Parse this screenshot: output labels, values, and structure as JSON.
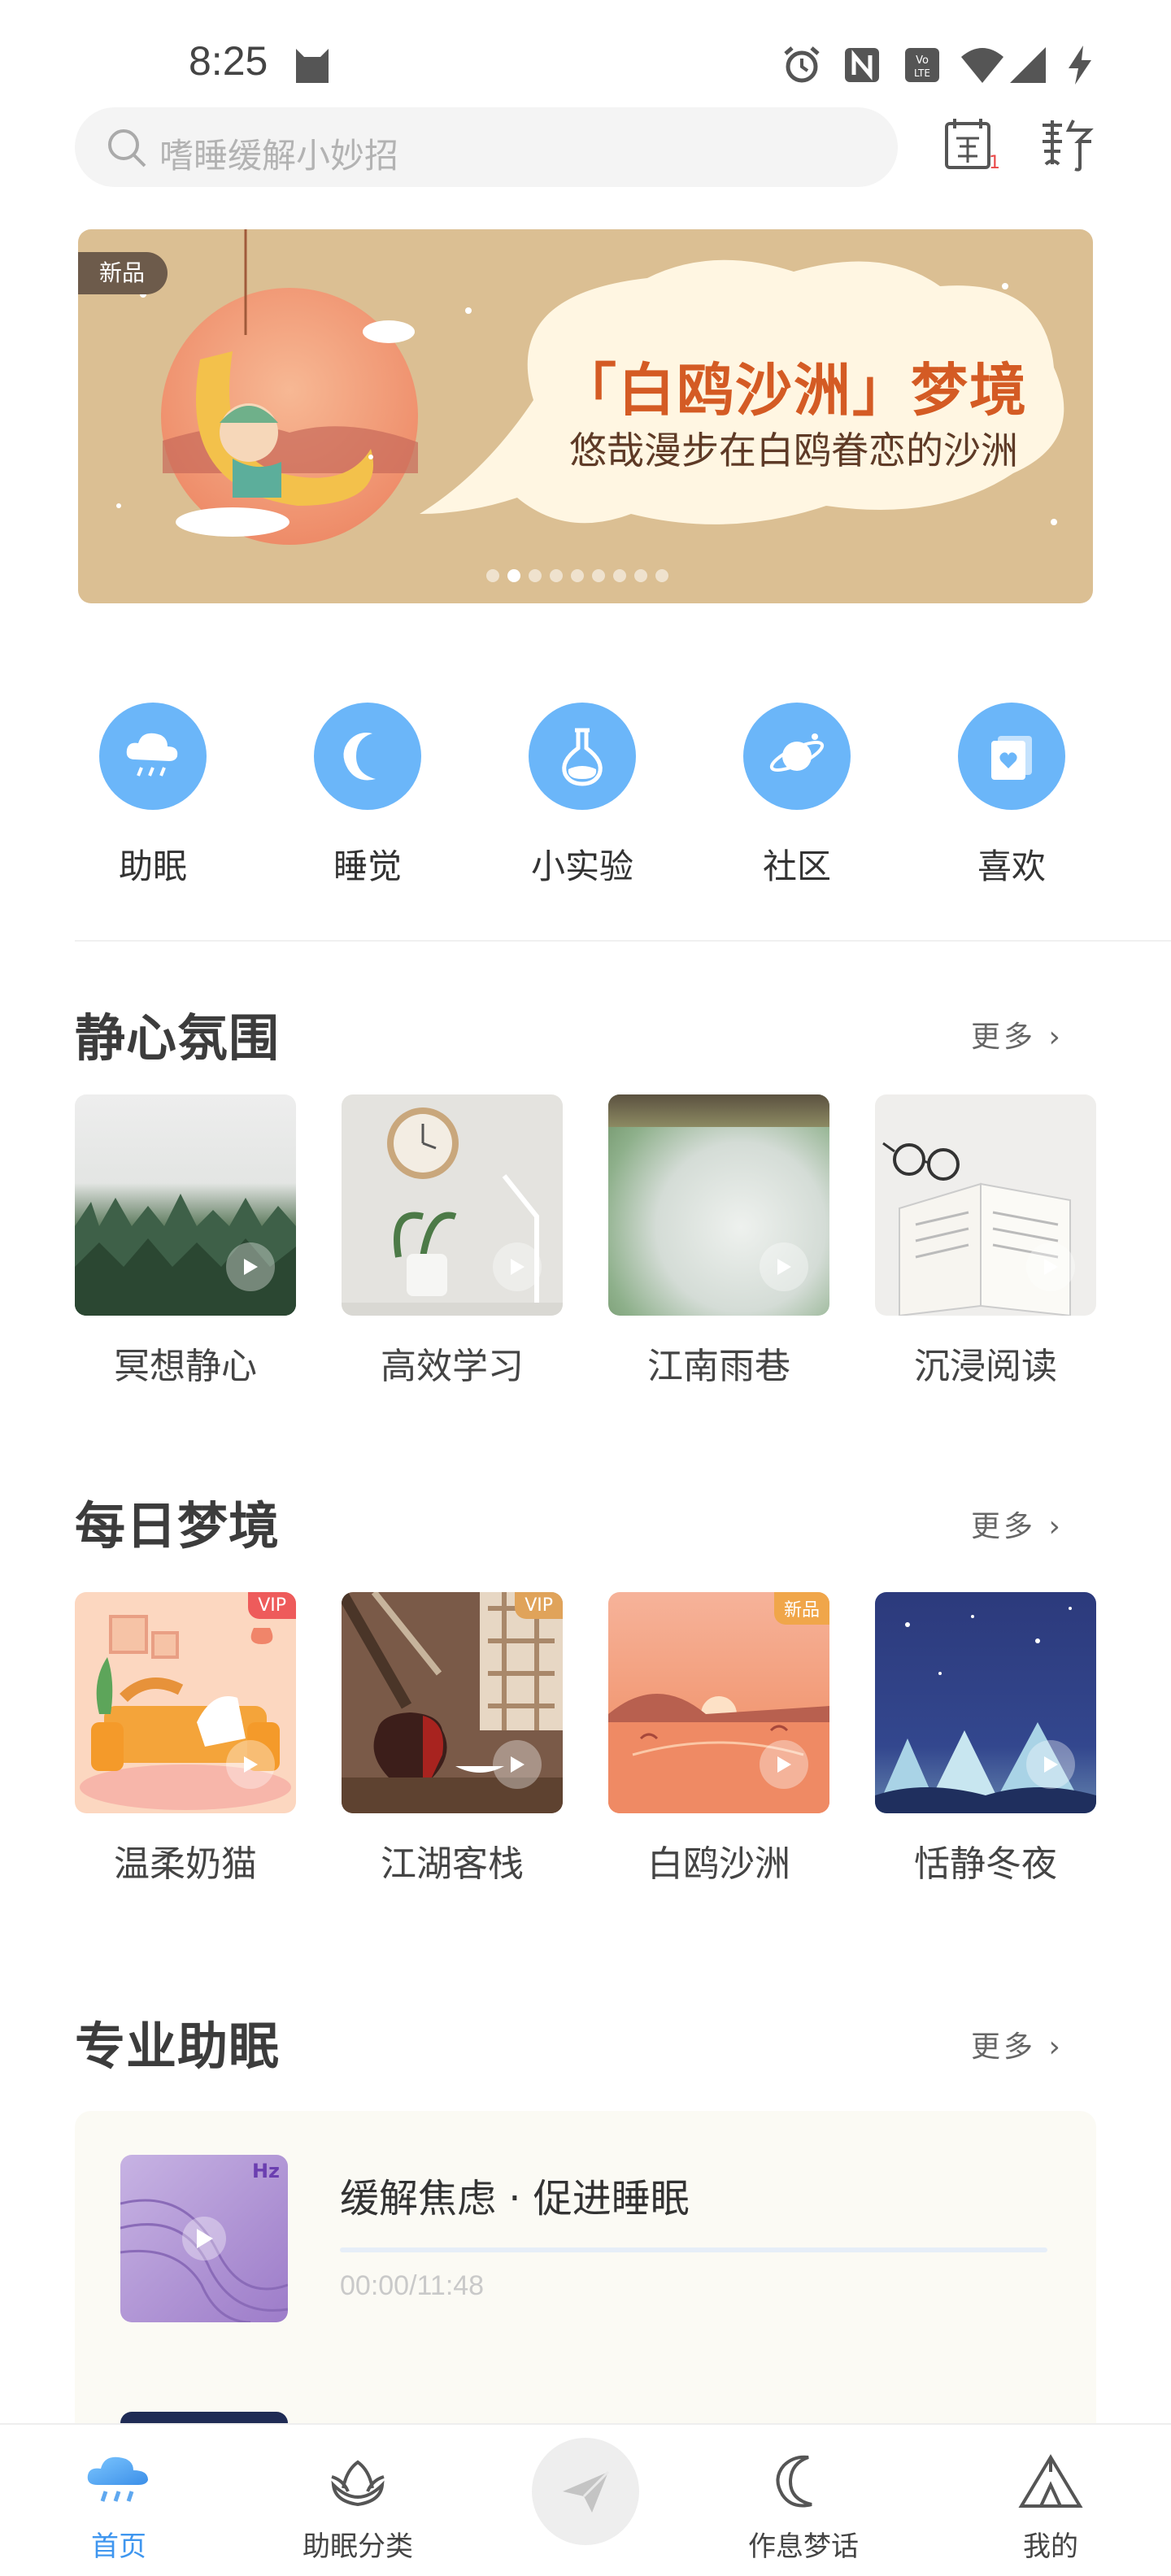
{
  "status_bar": {
    "time": "8:25"
  },
  "search": {
    "placeholder": "嗜睡缓解小妙招"
  },
  "header_right": {
    "checkin_badge": "1"
  },
  "banner": {
    "badge": "新品",
    "title": "「白鸥沙洲」梦境",
    "subtitle": "悠哉漫步在白鸥眷恋的沙洲",
    "page_count": 9,
    "active_page": 2
  },
  "quick_nav": [
    {
      "label": "助眠",
      "icon": "cloud-rain-icon"
    },
    {
      "label": "睡觉",
      "icon": "moon-icon"
    },
    {
      "label": "小实验",
      "icon": "flask-icon"
    },
    {
      "label": "社区",
      "icon": "planet-icon"
    },
    {
      "label": "喜欢",
      "icon": "heart-card-icon"
    }
  ],
  "sections": {
    "calm": {
      "title": "静心氛围",
      "more": "更多",
      "items": [
        {
          "label": "冥想静心"
        },
        {
          "label": "高效学习"
        },
        {
          "label": "江南雨巷"
        },
        {
          "label": "沉浸阅读"
        }
      ]
    },
    "dreams": {
      "title": "每日梦境",
      "more": "更多",
      "items": [
        {
          "label": "温柔奶猫",
          "tag": "VIP"
        },
        {
          "label": "江湖客栈",
          "tag": "VIP"
        },
        {
          "label": "白鸥沙洲",
          "tag": "新品"
        },
        {
          "label": "恬静冬夜",
          "tag": ""
        }
      ]
    },
    "pro": {
      "title": "专业助眠",
      "more": "更多",
      "track": {
        "title": "缓解焦虑 · 促进睡眠",
        "time": "00:00/11:48",
        "art_label": "Hz"
      }
    }
  },
  "tabs": [
    {
      "label": "首页",
      "icon": "cloud-rain-icon",
      "active": true
    },
    {
      "label": "助眠分类",
      "icon": "lotus-icon",
      "active": false
    },
    {
      "label": "",
      "icon": "paper-plane-icon",
      "active": false
    },
    {
      "label": "作息梦话",
      "icon": "moon-icon",
      "active": false
    },
    {
      "label": "我的",
      "icon": "tent-icon",
      "active": false
    }
  ],
  "colors": {
    "accent": "#6bb6f9",
    "banner_bg": "#dbbf93",
    "title_orange": "#d45b24"
  }
}
